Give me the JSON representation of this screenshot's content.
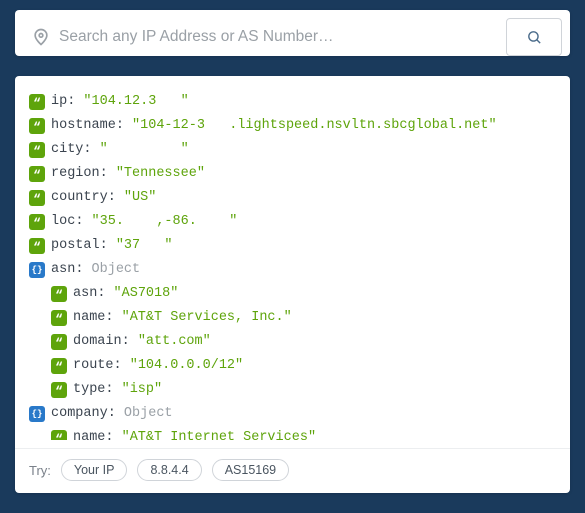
{
  "search": {
    "placeholder": "Search any IP Address or AS Number…"
  },
  "result": {
    "ip": {
      "key": "ip",
      "value": "\"104.12.3   \""
    },
    "hostname": {
      "key": "hostname",
      "value": "\"104-12-3   .lightspeed.nsvltn.sbcglobal.net\""
    },
    "city": {
      "key": "city",
      "value": "\"         \""
    },
    "region": {
      "key": "region",
      "value": "\"Tennessee\""
    },
    "country": {
      "key": "country",
      "value": "\"US\""
    },
    "loc": {
      "key": "loc",
      "value": "\"35.    ,-86.    \""
    },
    "postal": {
      "key": "postal",
      "value": "\"37   \""
    },
    "asn": {
      "key": "asn",
      "type": "Object",
      "asn": {
        "key": "asn",
        "value": "\"AS7018\""
      },
      "name": {
        "key": "name",
        "value": "\"AT&T Services, Inc.\""
      },
      "domain": {
        "key": "domain",
        "value": "\"att.com\""
      },
      "route": {
        "key": "route",
        "value": "\"104.0.0.0/12\""
      },
      "itype": {
        "key": "type",
        "value": "\"isp\""
      }
    },
    "company": {
      "key": "company",
      "type": "Object",
      "name": {
        "key": "name",
        "value": "\"AT&T Internet Services\""
      }
    }
  },
  "try": {
    "label": "Try:",
    "chips": [
      "Your IP",
      "8.8.4.4",
      "AS15169"
    ]
  }
}
